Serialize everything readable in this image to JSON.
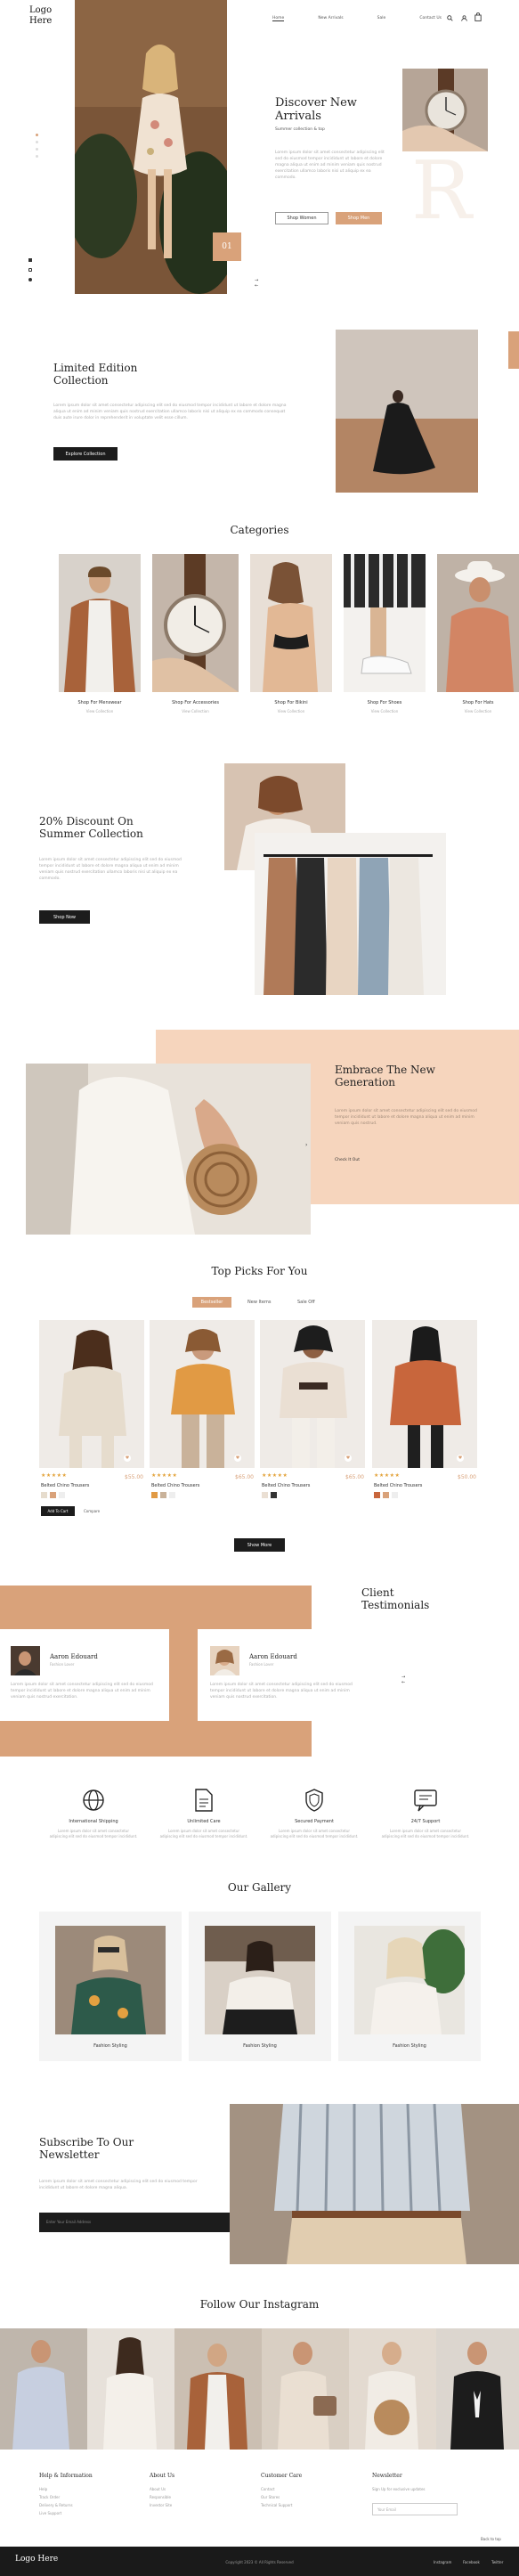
{
  "header": {
    "logo": "Logo Here",
    "nav": [
      "Home",
      "New Arrivals",
      "Sale",
      "Contact Us"
    ],
    "slide_number": "01"
  },
  "hero": {
    "title": "Discover New Arrivals",
    "subtitle": "Summer collection & top",
    "paragraph": "Lorem ipsum dolor sit amet consectetur adipiscing elit sed do eiusmod tempor incididunt ut labore et dolore magna aliqua ut enim ad minim veniam quis nostrud exercitation ullamco laboris nisi ut aliquip ex ea commodo.",
    "btn_explore": "Shop Women",
    "btn_shop": "Shop Men",
    "watermark": "R"
  },
  "limited": {
    "title": "Limited Edition Collection",
    "paragraph": "Lorem ipsum dolor sit amet consectetur adipiscing elit sed do eiusmod tempor incididunt ut labore et dolore magna aliqua ut enim ad minim veniam quis nostrud exercitation ullamco laboris nisi ut aliquip ex ea commodo consequat duis aute irure dolor in reprehenderit in voluptate velit esse cillum.",
    "button": "Explore Collection"
  },
  "categories": {
    "title": "Categories",
    "items": [
      {
        "label": "Shop For Menswear",
        "sub": "View Collection"
      },
      {
        "label": "Shop For Accessories",
        "sub": "View Collection"
      },
      {
        "label": "Shop For Bikini",
        "sub": "View Collection"
      },
      {
        "label": "Shop For Shoes",
        "sub": "View Collection"
      },
      {
        "label": "Shop For Hats",
        "sub": "View Collection"
      }
    ]
  },
  "discount": {
    "title": "20% Discount On Summer Collection",
    "paragraph": "Lorem ipsum dolor sit amet consectetur adipiscing elit sed do eiusmod tempor incididunt ut labore et dolore magna aliqua ut enim ad minim veniam quis nostrud exercitation ullamco laboris nisi ut aliquip ex ea commodo.",
    "button": "Shop Now"
  },
  "embrace": {
    "title": "Embrace The New Generation",
    "paragraph": "Lorem ipsum dolor sit amet consectetur adipiscing elit sed do eiusmod tempor incididunt ut labore et dolore magna aliqua ut enim ad minim veniam quis nostrud.",
    "link": "Check It Out"
  },
  "top_picks": {
    "title": "Top Picks For You",
    "tabs": [
      "Bestseller",
      "New Items",
      "Sale Off"
    ],
    "products": [
      {
        "name": "Belted Chino Trousers",
        "price": "$55.00"
      },
      {
        "name": "Belted Chino Trousers",
        "price": "$65.00"
      },
      {
        "name": "Belted Chino Trousers",
        "price": "$65.00"
      },
      {
        "name": "Belted Chino Trousers",
        "price": "$50.00"
      }
    ],
    "add_to_cart": "Add To Cart",
    "compare": "Compare",
    "show_more": "Show More"
  },
  "testimonials": {
    "title": "Client Testimonials",
    "items": [
      {
        "name": "Aaron Edouard",
        "role": "Fashion Lover",
        "text": "Lorem ipsum dolor sit amet consectetur adipiscing elit sed do eiusmod tempor incididunt ut labore et dolore magna aliqua ut enim ad minim veniam quis nostrud exercitation."
      },
      {
        "name": "Aaron Edouard",
        "role": "Fashion Lover",
        "text": "Lorem ipsum dolor sit amet consectetur adipiscing elit sed do eiusmod tempor incididunt ut labore et dolore magna aliqua ut enim ad minim veniam quis nostrud exercitation."
      }
    ]
  },
  "features": [
    {
      "icon": "globe-icon",
      "title": "International Shipping",
      "text": "Lorem ipsum dolor sit amet consectetur adipiscing elit sed do eiusmod tempor incididunt."
    },
    {
      "icon": "document-icon",
      "title": "Unlimited Care",
      "text": "Lorem ipsum dolor sit amet consectetur adipiscing elit sed do eiusmod tempor incididunt."
    },
    {
      "icon": "shield-icon",
      "title": "Secured Payment",
      "text": "Lorem ipsum dolor sit amet consectetur adipiscing elit sed do eiusmod tempor incididunt."
    },
    {
      "icon": "chat-icon",
      "title": "24/7 Support",
      "text": "Lorem ipsum dolor sit amet consectetur adipiscing elit sed do eiusmod tempor incididunt."
    }
  ],
  "gallery": {
    "title": "Our Gallery",
    "items": [
      "Fashion Styling",
      "Fashion Styling",
      "Fashion Styling"
    ]
  },
  "newsletter": {
    "title": "Subscribe To Our Newsletter",
    "paragraph": "Lorem ipsum dolor sit amet consectetur adipiscing elit sed do eiusmod tempor incididunt ut labore et dolore magna aliqua.",
    "placeholder": "Enter Your Email Address"
  },
  "instagram": {
    "title": "Follow Our Instagram"
  },
  "footer": {
    "columns": [
      {
        "title": "Help & Information",
        "items": [
          "Help",
          "Track Order",
          "Delivery & Returns",
          "Live Support"
        ]
      },
      {
        "title": "About Us",
        "items": [
          "About Us",
          "Responsible",
          "Investor Site"
        ]
      },
      {
        "title": "Customer Care",
        "items": [
          "Contact",
          "Our Stores",
          "Technical Support"
        ]
      },
      {
        "title": "Newsletter",
        "items": [
          "Sign Up for exclusive updates"
        ]
      }
    ],
    "newsletter_placeholder": "Your Email",
    "back_to_top": "Back to top",
    "bottom_logo": "Logo Here",
    "copyright": "Copyright 2023 © All Rights Reserved",
    "social": [
      "Instagram",
      "Facebook",
      "Twitter"
    ]
  },
  "colors": {
    "accent": "#d9a27a",
    "accent_light": "#f6d5bd",
    "dark": "#1c1c1c",
    "footer_bg": "#1a1a1a"
  }
}
